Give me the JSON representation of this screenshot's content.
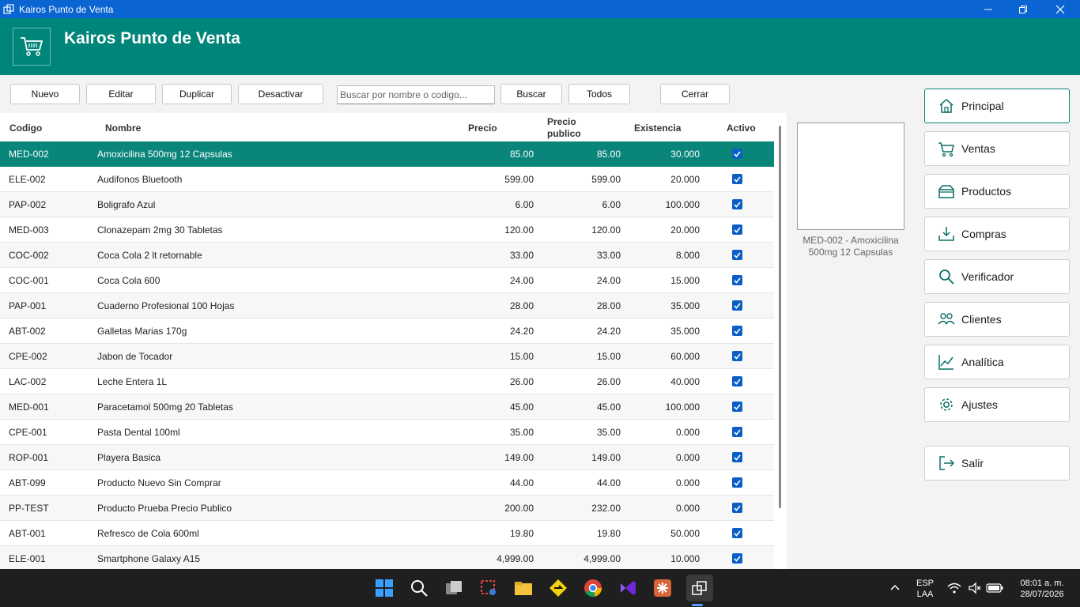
{
  "window": {
    "title": "Kairos Punto de Venta"
  },
  "header": {
    "app_name": "Kairos Punto de Venta"
  },
  "toolbar": {
    "nuevo": "Nuevo",
    "editar": "Editar",
    "duplicar": "Duplicar",
    "desactivar": "Desactivar",
    "search_placeholder": "Buscar por nombre o codigo...",
    "buscar": "Buscar",
    "todos": "Todos",
    "cerrar": "Cerrar"
  },
  "table": {
    "headers": {
      "codigo": "Codigo",
      "nombre": "Nombre",
      "precio": "Precio",
      "precio_publico_1": "Precio",
      "precio_publico_2": "publico",
      "existencia": "Existencia",
      "activo": "Activo"
    },
    "rows": [
      {
        "codigo": "MED-002",
        "nombre": "Amoxicilina 500mg 12 Capsulas",
        "precio": "85.00",
        "publico": "85.00",
        "existencia": "30.000",
        "activo": true
      },
      {
        "codigo": "ELE-002",
        "nombre": "Audifonos Bluetooth",
        "precio": "599.00",
        "publico": "599.00",
        "existencia": "20.000",
        "activo": true
      },
      {
        "codigo": "PAP-002",
        "nombre": "Boligrafo Azul",
        "precio": "6.00",
        "publico": "6.00",
        "existencia": "100.000",
        "activo": true
      },
      {
        "codigo": "MED-003",
        "nombre": "Clonazepam 2mg 30 Tabletas",
        "precio": "120.00",
        "publico": "120.00",
        "existencia": "20.000",
        "activo": true
      },
      {
        "codigo": "COC-002",
        "nombre": "Coca Cola 2 lt retornable",
        "precio": "33.00",
        "publico": "33.00",
        "existencia": "8.000",
        "activo": true
      },
      {
        "codigo": "COC-001",
        "nombre": "Coca Cola 600",
        "precio": "24.00",
        "publico": "24.00",
        "existencia": "15.000",
        "activo": true
      },
      {
        "codigo": "PAP-001",
        "nombre": "Cuaderno Profesional 100 Hojas",
        "precio": "28.00",
        "publico": "28.00",
        "existencia": "35.000",
        "activo": true
      },
      {
        "codigo": "ABT-002",
        "nombre": "Galletas Marias 170g",
        "precio": "24.20",
        "publico": "24.20",
        "existencia": "35.000",
        "activo": true
      },
      {
        "codigo": "CPE-002",
        "nombre": "Jabon de Tocador",
        "precio": "15.00",
        "publico": "15.00",
        "existencia": "60.000",
        "activo": true
      },
      {
        "codigo": "LAC-002",
        "nombre": "Leche Entera 1L",
        "precio": "26.00",
        "publico": "26.00",
        "existencia": "40.000",
        "activo": true
      },
      {
        "codigo": "MED-001",
        "nombre": "Paracetamol 500mg 20 Tabletas",
        "precio": "45.00",
        "publico": "45.00",
        "existencia": "100.000",
        "activo": true
      },
      {
        "codigo": "CPE-001",
        "nombre": "Pasta Dental 100ml",
        "precio": "35.00",
        "publico": "35.00",
        "existencia": "0.000",
        "activo": true
      },
      {
        "codigo": "ROP-001",
        "nombre": "Playera Basica",
        "precio": "149.00",
        "publico": "149.00",
        "existencia": "0.000",
        "activo": true
      },
      {
        "codigo": "ABT-099",
        "nombre": "Producto Nuevo Sin Comprar",
        "precio": "44.00",
        "publico": "44.00",
        "existencia": "0.000",
        "activo": true
      },
      {
        "codigo": "PP-TEST",
        "nombre": "Producto Prueba Precio Publico",
        "precio": "200.00",
        "publico": "232.00",
        "existencia": "0.000",
        "activo": true
      },
      {
        "codigo": "ABT-001",
        "nombre": "Refresco de Cola 600ml",
        "precio": "19.80",
        "publico": "19.80",
        "existencia": "50.000",
        "activo": true
      },
      {
        "codigo": "ELE-001",
        "nombre": "Smartphone Galaxy A15",
        "precio": "4,999.00",
        "publico": "4,999.00",
        "existencia": "10.000",
        "activo": true
      }
    ]
  },
  "preview": {
    "caption_line1": "MED-002 - Amoxicilina",
    "caption_line2": "500mg 12 Capsulas"
  },
  "sidebar": {
    "items": [
      {
        "label": "Principal",
        "icon": "home-icon"
      },
      {
        "label": "Ventas",
        "icon": "cart-icon"
      },
      {
        "label": "Productos",
        "icon": "box-icon"
      },
      {
        "label": "Compras",
        "icon": "download-icon"
      },
      {
        "label": "Verificador",
        "icon": "search-icon"
      },
      {
        "label": "Clientes",
        "icon": "users-icon"
      },
      {
        "label": "Analítica",
        "icon": "chart-icon"
      },
      {
        "label": "Ajustes",
        "icon": "gear-icon"
      }
    ],
    "salir": "Salir"
  },
  "taskbar": {
    "lang_1": "ESP",
    "lang_2": "LAA",
    "time": "08:01 a. m.",
    "date": "28/07/2026"
  },
  "colors": {
    "header": "#00857a",
    "titlebar": "#0a64d2",
    "selected_row": "#0a857a",
    "checkbox": "#0a5fc4"
  }
}
